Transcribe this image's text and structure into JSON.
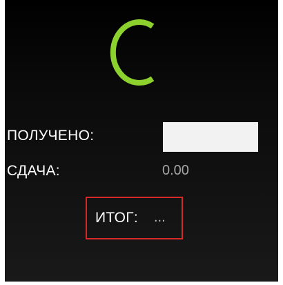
{
  "colors": {
    "spinner": "#8cd12e",
    "highlight_border": "#d62a2a",
    "background": "#000000",
    "muted_text": "#a6a6a6"
  },
  "spinner": {
    "icon": "loading-spinner-icon"
  },
  "received": {
    "label": "ПОЛУЧЕНО:",
    "value": "",
    "placeholder": ""
  },
  "change": {
    "label": "СДАЧА:",
    "value": "0.00"
  },
  "total": {
    "label": "ИТОГ:",
    "value": "..."
  }
}
